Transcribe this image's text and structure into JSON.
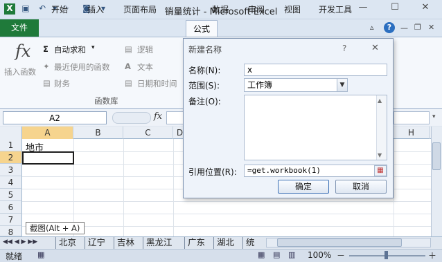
{
  "window": {
    "title": "销量统计 - Microsoft Excel",
    "minimize_glyph": "—",
    "maximize_glyph": "☐",
    "close_glyph": "✕"
  },
  "ribbon": {
    "file_tab": "文件",
    "tabs": [
      "开始",
      "插入",
      "页面布局",
      "公式",
      "数据",
      "审阅",
      "视图",
      "开发工具"
    ],
    "active_tab": "公式",
    "insert_function": "插入函数",
    "autosum": "自动求和",
    "recent": "最近使用的函数",
    "financial": "财务",
    "logical": "逻辑",
    "text": "文本",
    "datetime": "日期和时间",
    "group_label": "函数库",
    "fx_symbol": "fx",
    "sigma": "Σ"
  },
  "formula_bar": {
    "name_box": "A2",
    "fx": "fx"
  },
  "grid": {
    "columns": [
      "A",
      "B",
      "C",
      "D",
      "H"
    ],
    "rows": [
      "1",
      "2",
      "3",
      "4",
      "5",
      "6",
      "7",
      "8"
    ],
    "cell_A1": "地市"
  },
  "sheets": {
    "tabs": [
      "北京",
      "辽宁",
      "吉林",
      "黑龙江",
      "广东",
      "湖北",
      "统"
    ]
  },
  "status": {
    "ready": "就绪",
    "zoom": "100%",
    "minus": "－",
    "plus": "＋"
  },
  "tooltip": "截图(Alt + A)",
  "dialog": {
    "title": "新建名称",
    "help": "?",
    "close": "✕",
    "name_label": "名称(N):",
    "name_value": "x",
    "scope_label": "范围(S):",
    "scope_value": "工作簿",
    "comment_label": "备注(O):",
    "refers_label": "引用位置(R):",
    "refers_value": "=get.workbook(1)",
    "ok": "确定",
    "cancel": "取消"
  }
}
